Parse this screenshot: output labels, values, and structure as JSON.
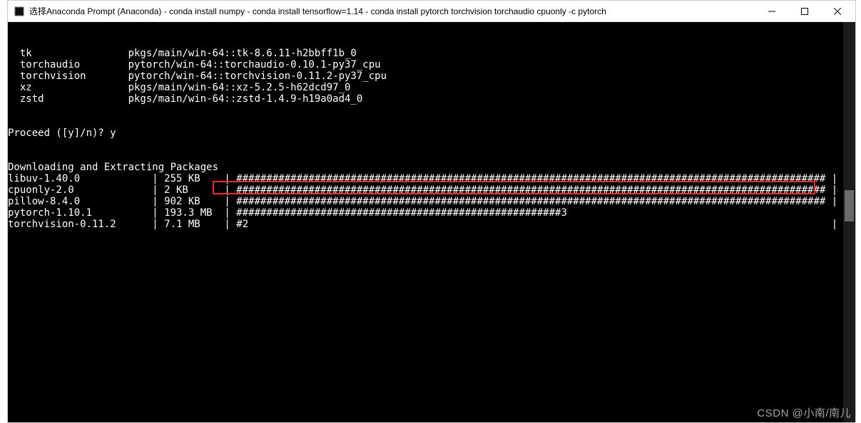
{
  "titlebar": {
    "title": "选择Anaconda Prompt (Anaconda) - conda  install numpy - conda  install tensorflow=1.14 - conda  install pytorch torchvision torchaudio cpuonly -c pytorch"
  },
  "pkg_lines": [
    {
      "name": "  tk",
      "spec": "pkgs/main/win-64::tk-8.6.11-h2bbff1b_0"
    },
    {
      "name": "  torchaudio",
      "spec": "pytorch/win-64::torchaudio-0.10.1-py37_cpu"
    },
    {
      "name": "  torchvision",
      "spec": "pytorch/win-64::torchvision-0.11.2-py37_cpu"
    },
    {
      "name": "  xz",
      "spec": "pkgs/main/win-64::xz-5.2.5-h62dcd97_0"
    },
    {
      "name": "  zstd",
      "spec": "pkgs/main/win-64::zstd-1.4.9-h19a0ad4_0"
    }
  ],
  "proceed": "Proceed ([y]/n)? y",
  "dl_header": "Downloading and Extracting Packages",
  "downloads": [
    {
      "name": "libuv-1.40.0",
      "size": "255 KB",
      "bar": "################################################################################################## |",
      "pct": "100%"
    },
    {
      "name": "cpuonly-2.0",
      "size": "2 KB",
      "bar": "################################################################################################## |",
      "pct": "100%"
    },
    {
      "name": "pillow-8.4.0",
      "size": "902 KB",
      "bar": "################################################################################################## |",
      "pct": "100%"
    },
    {
      "name": "pytorch-1.10.1",
      "size": "193.3 MB",
      "bar": "######################################################3                                              ",
      "pct": " 56%"
    },
    {
      "name": "torchvision-0.11.2",
      "size": "7.1 MB",
      "bar": "#2                                                                                                 | ",
      "pct": " 1%"
    }
  ],
  "watermark": "CSDN @小南/南儿"
}
